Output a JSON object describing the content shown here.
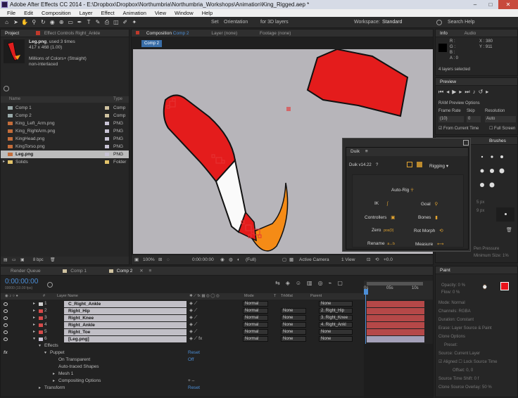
{
  "window": {
    "title": "Adobe After Effects CC 2014 - E:\\Dropbox\\Dropbox\\Northumbria\\Northumbria_Workshops\\Animation\\King_Rigged.aep *",
    "minimize": "–",
    "maximize": "□",
    "close": "✕"
  },
  "menu": [
    "File",
    "Edit",
    "Composition",
    "Layer",
    "Effect",
    "Animation",
    "View",
    "Window",
    "Help"
  ],
  "toolbar": {
    "set_label": "Set",
    "orientation": "Orientation",
    "for3d": "for 3D layers",
    "workspace_label": "Workspace:",
    "workspace": "Standard",
    "search": "Search Help"
  },
  "project": {
    "tabs": {
      "project": "Project",
      "effect_controls": "Effect Controls Right_Ankle"
    },
    "file_name": "Leg.png",
    "file_usage": ", used 3 times",
    "file_dims": "417 x 468 (1.00)",
    "file_colors": "Millions of Colors+ (Straight)",
    "file_interlace": "non-interlaced",
    "col_name": "Name",
    "col_type": "Type",
    "items": [
      {
        "name": "Comp 1",
        "type": "Comp",
        "color": "#cfc2a0",
        "icon": "comp-icon"
      },
      {
        "name": "Comp 2",
        "type": "Comp",
        "color": "#cfc2a0",
        "icon": "comp-icon"
      },
      {
        "name": "King_Left_Arm.png",
        "type": "PNG",
        "color": "#c9c4d6",
        "icon": "image-icon"
      },
      {
        "name": "King_RightArm.png",
        "type": "PNG",
        "color": "#c9c4d6",
        "icon": "image-icon"
      },
      {
        "name": "KingHead.png",
        "type": "PNG",
        "color": "#c9c4d6",
        "icon": "image-icon"
      },
      {
        "name": "KingTorso.png",
        "type": "PNG",
        "color": "#c9c4d6",
        "icon": "image-icon"
      },
      {
        "name": "Leg.png",
        "type": "PNG",
        "color": "#c9c4d6",
        "icon": "image-icon",
        "selected": true
      },
      {
        "name": "Solids",
        "type": "Folder",
        "color": "#e3c36a",
        "icon": "folder-icon"
      }
    ],
    "bpc": "8 bpc"
  },
  "comp": {
    "tabs": {
      "composition": "Composition",
      "comp_name": "Comp 2",
      "layer": "Layer (none)",
      "footage": "Footage (none)"
    },
    "flow_tab": "Comp 2",
    "zoom": "100%",
    "timecode": "0:00:00:00",
    "resolution": "(Full)",
    "camera": "Active Camera",
    "view": "1 View"
  },
  "info": {
    "tabs": {
      "info": "Info",
      "audio": "Audio"
    },
    "r": "R :",
    "g": "G :",
    "b": "B :",
    "a": "A : 0",
    "x": "X : 380",
    "y": "Y : 911",
    "selected": "4 layers selected"
  },
  "preview": {
    "title": "Preview",
    "ram_options": "RAM Preview Options",
    "frame_rate_label": "Frame Rate",
    "skip_label": "Skip",
    "resolution_label": "Resolution",
    "frame_rate": "(10)",
    "skip": "0",
    "resolution": "Auto",
    "from_current": "From Current Time",
    "full_screen": "Full Screen"
  },
  "brushes": {
    "title": "Brushes",
    "sizes": [
      "5 px",
      "9 px"
    ],
    "pen_pressure": "Pen Pressure",
    "min_size": "Minimum Size: 1%"
  },
  "duik": {
    "title": "Duik",
    "version": "Duik v14.22",
    "help": "?",
    "mode": "Rigging",
    "auto_rig": "Auto-Rig",
    "ik": "IK",
    "goal": "Goal",
    "controllers": "Controllers",
    "bones": "Bones",
    "zero": "Zero",
    "rot_morph": "Rot Morph",
    "rename": "Rename",
    "measure": "Measure"
  },
  "timeline": {
    "tabs": [
      "Render Queue",
      "Comp 1",
      "Comp 2"
    ],
    "timecode": "0:00:00:00",
    "fps": "00000 (10.00 fps)",
    "col_layer": "Layer Name",
    "col_mode": "Mode",
    "col_t": "T",
    "col_trkmat": "TrkMat",
    "col_parent": "Parent",
    "ruler": [
      "0s",
      "05s",
      "10s"
    ],
    "layers": [
      {
        "num": "1",
        "name": "C_Right_Ankle",
        "mode": "Normal",
        "trkmat": "",
        "parent": "None"
      },
      {
        "num": "2",
        "name": "Right_Hip",
        "mode": "Normal",
        "trkmat": "None",
        "parent": "2. Right_Hip"
      },
      {
        "num": "3",
        "name": "Right_Knee",
        "mode": "Normal",
        "trkmat": "None",
        "parent": "3. Right_Knee"
      },
      {
        "num": "4",
        "name": "Right_Ankle",
        "mode": "Normal",
        "trkmat": "None",
        "parent": "4. Right_Ankl"
      },
      {
        "num": "5",
        "name": "Right_Toe",
        "mode": "Normal",
        "trkmat": "None",
        "parent": "None"
      },
      {
        "num": "6",
        "name": "[Leg.png]",
        "mode": "Normal",
        "trkmat": "None",
        "parent": "None"
      }
    ],
    "props": {
      "effects": "Effects",
      "puppet": "Puppet",
      "reset": "Reset",
      "on_transparent": "On Transparent",
      "off": "Off",
      "auto_traced": "Auto-traced Shapes",
      "mesh1": "Mesh 1",
      "compositing": "Compositing Options",
      "plusminus": "+ –",
      "transform": "Transform",
      "reset2": "Reset"
    },
    "fx": "fx"
  },
  "paint": {
    "title": "Paint",
    "opacity": "Opacity: 0 %",
    "flow": "Flow: 0 %",
    "mode": "Mode: Normal",
    "channels": "Channels: RGBA",
    "duration": "Duration: Constant",
    "erase": "Erase: Layer Source & Paint",
    "clone_options": "Clone Options",
    "preset": "Preset:",
    "source": "Source: Current Layer",
    "aligned": "Aligned",
    "lock_source": "Lock Source Time",
    "offset": "Offset: 0, 0",
    "source_time_shift": "Source Time Shift: 0 f",
    "clone_overlay": "Clone Source Overlay: 50 %",
    "fg_color": "#e8121a"
  }
}
